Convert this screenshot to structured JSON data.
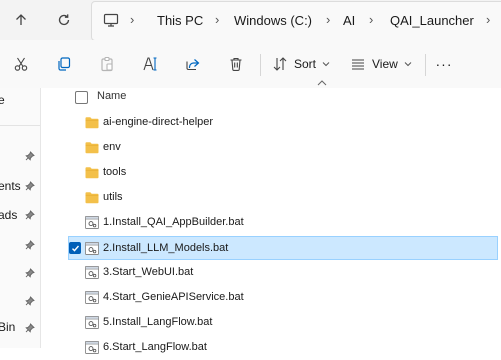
{
  "address": {
    "crumbs": [
      "This PC",
      "Windows (C:)",
      "AI",
      "QAI_Launcher"
    ]
  },
  "toolbar": {
    "sort_label": "Sort",
    "view_label": "View",
    "more_label": "···"
  },
  "file_list": {
    "column_name": "Name",
    "items": [
      {
        "name": "ai-engine-direct-helper",
        "type": "folder",
        "selected": false
      },
      {
        "name": "env",
        "type": "folder",
        "selected": false
      },
      {
        "name": "tools",
        "type": "folder",
        "selected": false
      },
      {
        "name": "utils",
        "type": "folder",
        "selected": false
      },
      {
        "name": "1.Install_QAI_AppBuilder.bat",
        "type": "bat",
        "selected": false
      },
      {
        "name": "2.Install_LLM_Models.bat",
        "type": "bat",
        "selected": true
      },
      {
        "name": "3.Start_WebUI.bat",
        "type": "bat",
        "selected": false
      },
      {
        "name": "4.Start_GenieAPIService.bat",
        "type": "bat",
        "selected": false
      },
      {
        "name": "5.Install_LangFlow.bat",
        "type": "bat",
        "selected": false
      },
      {
        "name": "6.Start_LangFlow.bat",
        "type": "bat",
        "selected": false
      }
    ]
  },
  "navpane": {
    "items": [
      "e",
      "",
      "ents",
      "ads",
      "",
      "",
      "",
      "Bin"
    ]
  },
  "colors": {
    "selection_bg": "#cce8ff",
    "selection_border": "#99d1ff",
    "accent": "#005fb8",
    "folder": "#f3c04a"
  }
}
